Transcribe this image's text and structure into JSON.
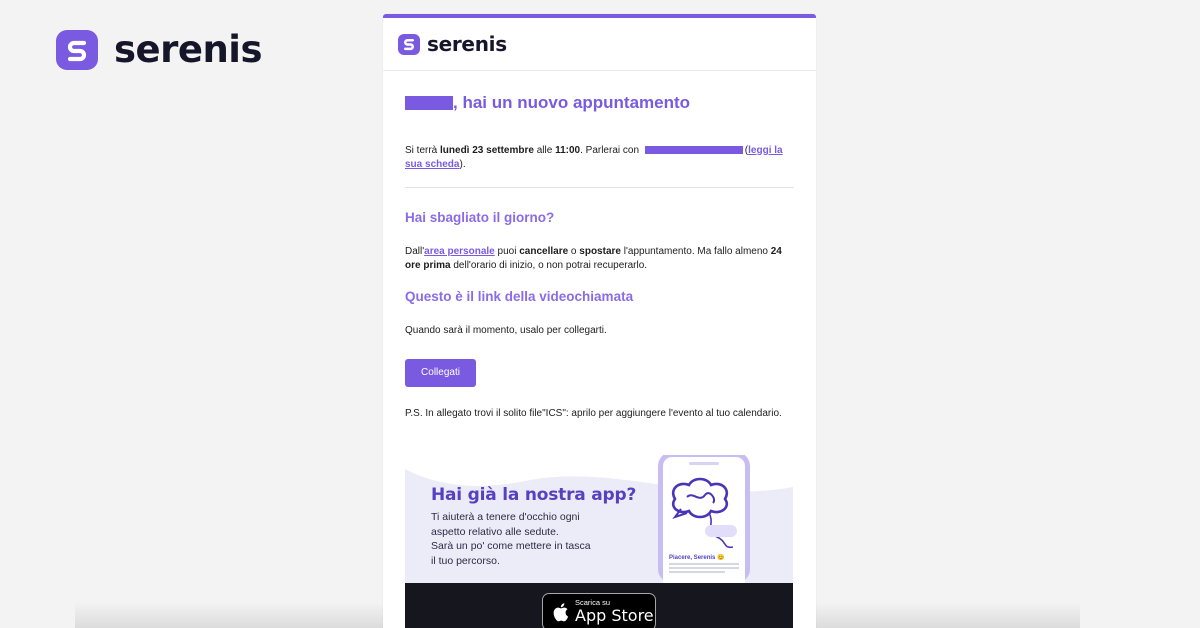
{
  "brand": {
    "name": "serenis"
  },
  "email": {
    "logo": "serenis",
    "headline": ", hai un nuovo appuntamento",
    "appointment": {
      "prefix": "Si terrà ",
      "date": "lunedì 23 settembre",
      "middle": " alle ",
      "time": "11:00",
      "suffix": ". Parlerai con ",
      "open_paren": "(",
      "link": "leggi la sua scheda",
      "close": ")."
    },
    "wrong_day": {
      "heading": "Hai sbagliato il giorno?",
      "t1": "Dall'",
      "link": "area personale",
      "t2": " puoi ",
      "b1": "cancellare",
      "t3": " o ",
      "b2": "spostare",
      "t4": " l'appuntamento. Ma fallo almeno ",
      "b3": "24 ore prima",
      "t5": " dell'orario di inizio, o non potrai recuperarlo."
    },
    "video": {
      "heading": "Questo è il link della videochiamata",
      "text": "Quando sarà il momento, usalo per collegarti.",
      "button": "Collegati"
    },
    "ps": "P.S. In allegato trovi il solito file\"ICS\": aprilo per aggiungere l'evento al tuo calendario.",
    "app_banner": {
      "title": "Hai già la nostra app?",
      "line1": "Ti aiuterà a tenere d'occhio ogni",
      "line2": "aspetto relativo alle sedute.",
      "line3": "Sarà un po' come mettere in tasca",
      "line4": "il tuo percorso.",
      "phone_caption": "Piacere, Serenis 😊",
      "store_small": "Scarica su",
      "store_big": "App Store"
    }
  },
  "colors": {
    "accent": "#7a5ae0",
    "heading": "#8b6be6",
    "banner_bg": "#ecebf8",
    "store_bg": "#16161f"
  },
  "icons": [
    "serenis-logo-icon",
    "apple-icon"
  ]
}
